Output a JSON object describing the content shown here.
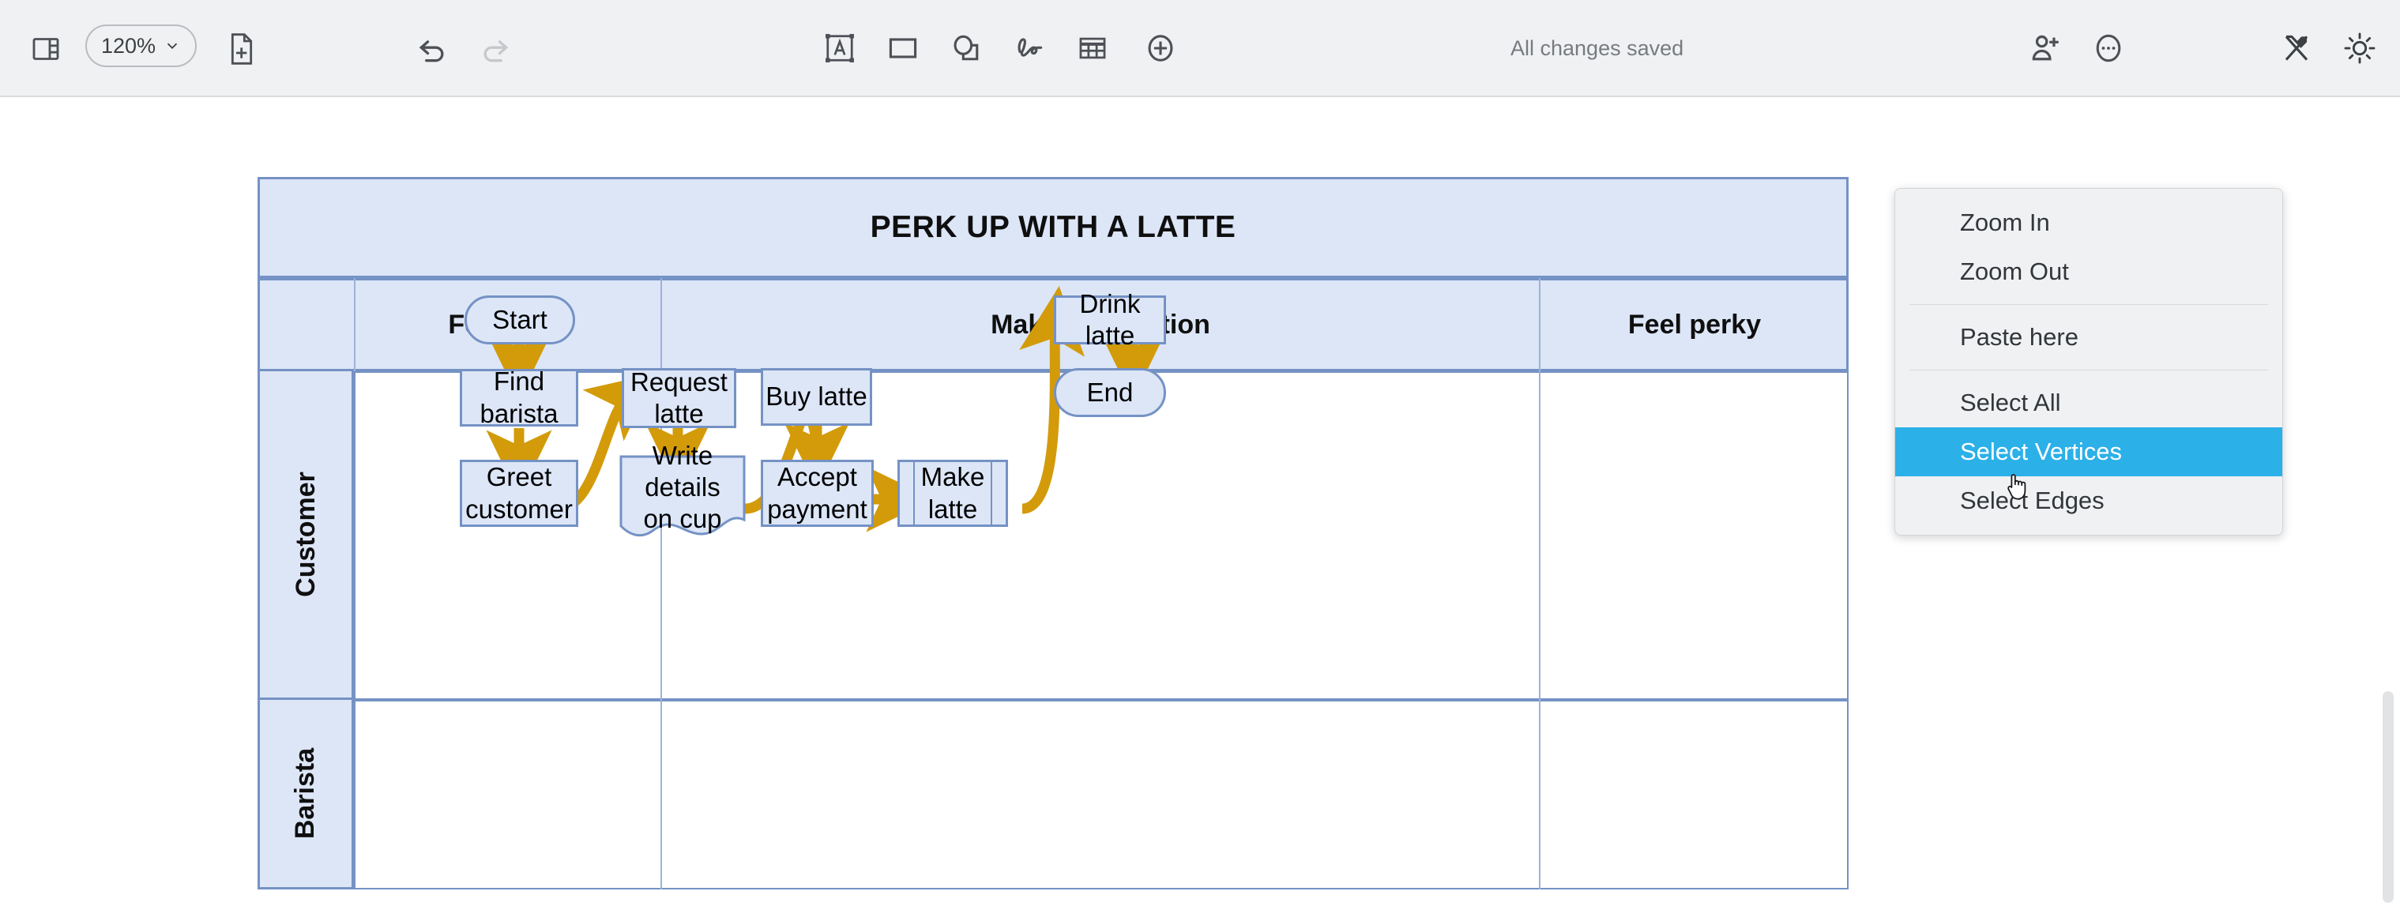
{
  "toolbar": {
    "left": [
      {
        "name": "toggle-sidebar-icon",
        "label": "Toggle sidebar"
      },
      {
        "name": "zoom-level-select",
        "label": "120%"
      },
      {
        "name": "new-page-icon",
        "label": "New page"
      }
    ],
    "zoom_level": "120%",
    "history": [
      {
        "name": "undo-icon",
        "label": "Undo",
        "enabled": true
      },
      {
        "name": "redo-icon",
        "label": "Redo",
        "enabled": false
      }
    ],
    "tools": [
      {
        "name": "text-box-icon",
        "label": "Text"
      },
      {
        "name": "rectangle-icon",
        "label": "Rectangle"
      },
      {
        "name": "shapes-icon",
        "label": "Shapes"
      },
      {
        "name": "freehand-icon",
        "label": "Freehand"
      },
      {
        "name": "table-icon",
        "label": "Table"
      },
      {
        "name": "add-icon",
        "label": "More shapes"
      }
    ],
    "status": "All changes saved",
    "right": [
      {
        "name": "add-person-icon",
        "label": "Share"
      },
      {
        "name": "more-options-icon",
        "label": "More options"
      },
      {
        "name": "format-icon",
        "label": "Format"
      },
      {
        "name": "theme-icon",
        "label": "Appearance"
      }
    ]
  },
  "context_menu": {
    "items": [
      {
        "label": "Zoom In",
        "active": false,
        "divider_after": false
      },
      {
        "label": "Zoom Out",
        "active": false,
        "divider_after": true
      },
      {
        "label": "Paste here",
        "active": false,
        "divider_after": true
      },
      {
        "label": "Select All",
        "active": false,
        "divider_after": false
      },
      {
        "label": "Select Vertices",
        "active": true,
        "divider_after": false
      },
      {
        "label": "Select Edges",
        "active": false,
        "divider_after": false
      }
    ]
  },
  "diagram": {
    "title": "PERK UP WITH A LATTE",
    "columns": [
      "Feel tired",
      "Make transaction",
      "Feel perky"
    ],
    "lanes": [
      "Customer",
      "Barista"
    ],
    "nodes": [
      {
        "id": "start",
        "label": "Start",
        "shape": "rounded",
        "lane": "Customer",
        "column": "Feel tired"
      },
      {
        "id": "find-barista",
        "label": "Find barista",
        "shape": "rectangle",
        "lane": "Customer",
        "column": "Feel tired"
      },
      {
        "id": "greet-customer",
        "label": "Greet\ncustomer",
        "shape": "rectangle",
        "lane": "Barista",
        "column": "Feel tired"
      },
      {
        "id": "request-latte",
        "label": "Request\nlatte",
        "shape": "rectangle",
        "lane": "Customer",
        "column": "Make transaction"
      },
      {
        "id": "write-details",
        "label": "Write details\non cup",
        "shape": "document",
        "lane": "Barista",
        "column": "Make transaction"
      },
      {
        "id": "buy-latte",
        "label": "Buy latte",
        "shape": "rectangle",
        "lane": "Customer",
        "column": "Make transaction"
      },
      {
        "id": "accept-payment",
        "label": "Accept\npayment",
        "shape": "rectangle",
        "lane": "Barista",
        "column": "Make transaction"
      },
      {
        "id": "make-latte",
        "label": "Make\nlatte",
        "shape": "predefined-process",
        "lane": "Barista",
        "column": "Make transaction"
      },
      {
        "id": "drink-latte",
        "label": "Drink latte",
        "shape": "rectangle",
        "lane": "Customer",
        "column": "Feel perky"
      },
      {
        "id": "end",
        "label": "End",
        "shape": "stadium",
        "lane": "Customer",
        "column": "Feel perky"
      }
    ],
    "edges": [
      {
        "from": "start",
        "to": "find-barista"
      },
      {
        "from": "find-barista",
        "to": "greet-customer"
      },
      {
        "from": "greet-customer",
        "to": "request-latte"
      },
      {
        "from": "request-latte",
        "to": "write-details"
      },
      {
        "from": "write-details",
        "to": "buy-latte"
      },
      {
        "from": "buy-latte",
        "to": "accept-payment"
      },
      {
        "from": "accept-payment",
        "to": "make-latte"
      },
      {
        "from": "make-latte",
        "to": "drink-latte"
      },
      {
        "from": "drink-latte",
        "to": "end"
      }
    ],
    "colors": {
      "shape_fill": "#dce6f7",
      "shape_stroke": "#7592c4",
      "edge": "#d39b0a",
      "text": "#000000"
    }
  },
  "nodes_text": {
    "start": "Start",
    "find_barista": "Find barista",
    "greet_customer_l1": "Greet",
    "greet_customer_l2": "customer",
    "request_latte_l1": "Request",
    "request_latte_l2": "latte",
    "write_details_l1": "Write details",
    "write_details_l2": "on cup",
    "buy_latte": "Buy latte",
    "accept_payment_l1": "Accept",
    "accept_payment_l2": "payment",
    "make_latte_l1": "Make",
    "make_latte_l2": "latte",
    "drink_latte": "Drink latte",
    "end": "End"
  }
}
